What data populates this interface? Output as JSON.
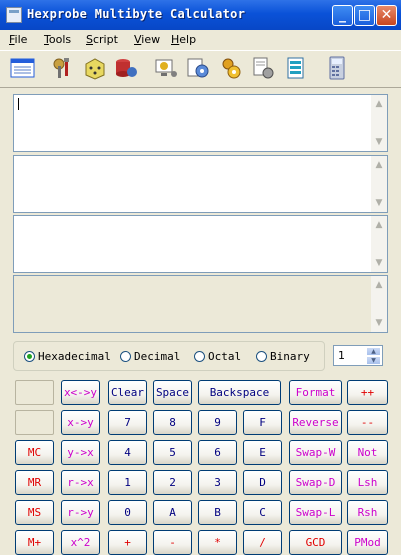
{
  "window": {
    "title": "Hexprobe Multibyte Calculator",
    "icon": "calculator-icon"
  },
  "titlebar_buttons": {
    "minimize": "_",
    "maximize": "□",
    "close": "✕"
  },
  "menu": [
    {
      "label": "File",
      "u": "F",
      "rest": "ile"
    },
    {
      "label": "Tools",
      "u": "T",
      "rest": "ools"
    },
    {
      "label": "Script",
      "u": "S",
      "rest": "cript"
    },
    {
      "label": "View",
      "u": "V",
      "rest": "iew"
    },
    {
      "label": "Help",
      "u": "H",
      "rest": "elp"
    }
  ],
  "toolbar": [
    "grid-view-icon",
    "tools-icon",
    "dice-icon",
    "data-storage-icon",
    "monitor-settings-icon",
    "gears-icon",
    "gear-settings-icon",
    "document-settings-icon",
    "text-align-icon",
    "calculator-icon"
  ],
  "panes": [
    {
      "value": "",
      "enabled": true
    },
    {
      "value": "",
      "enabled": true
    },
    {
      "value": "",
      "enabled": true
    },
    {
      "value": "",
      "enabled": false
    }
  ],
  "radix": {
    "options": [
      "Hexadecimal",
      "Decimal",
      "Octal",
      "Binary"
    ],
    "selected": "Hexadecimal"
  },
  "width_spinner": {
    "value": "1",
    "up": "▲",
    "down": "▼"
  },
  "keys": [
    [
      "",
      "x<->y",
      "Clear",
      "Space",
      "Backspace",
      "Format",
      "++"
    ],
    [
      "",
      "x->y",
      "7",
      "8",
      "9",
      "F",
      "Reverse",
      "--"
    ],
    [
      "MC",
      "y->x",
      "4",
      "5",
      "6",
      "E",
      "Swap-W",
      "Not"
    ],
    [
      "MR",
      "r->x",
      "1",
      "2",
      "3",
      "D",
      "Swap-D",
      "Lsh"
    ],
    [
      "MS",
      "r->y",
      "0",
      "A",
      "B",
      "C",
      "Swap-L",
      "Rsh"
    ],
    [
      "M+",
      "x^2",
      "+",
      "-",
      "*",
      "/",
      "GCD",
      "PMod"
    ]
  ],
  "colors": {
    "titlebar": "#0a52d8",
    "memory_keys": "#e00000",
    "register_keys": "#cc00cc",
    "digit_keys": "#000080",
    "background": "#ece9d8"
  }
}
